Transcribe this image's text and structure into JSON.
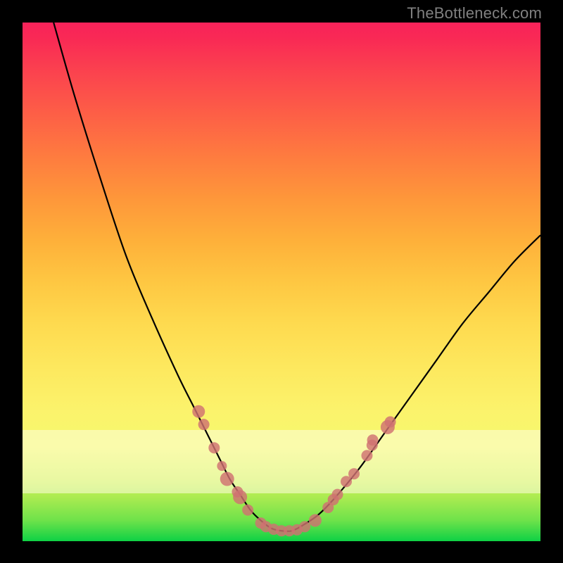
{
  "watermark": "TheBottleneck.com",
  "colors": {
    "frame": "#000000",
    "dot": "#d07272",
    "curve": "#000000",
    "gradient_top": "#f8225a",
    "gradient_bottom": "#0ed145"
  },
  "chart_data": {
    "type": "line",
    "title": "",
    "xlabel": "",
    "ylabel": "",
    "xlim": [
      0,
      100
    ],
    "ylim": [
      0,
      100
    ],
    "grid": false,
    "legend": false,
    "series": [
      {
        "name": "bottleneck-curve",
        "x": [
          6,
          10,
          15,
          20,
          25,
          30,
          33,
          36,
          38,
          40,
          42,
          44,
          46,
          48,
          50,
          52,
          54,
          57,
          60,
          65,
          70,
          75,
          80,
          85,
          90,
          95,
          100
        ],
        "values": [
          100,
          86,
          70,
          55,
          43,
          32,
          26,
          20,
          16,
          12,
          9,
          6,
          4,
          2.5,
          2,
          2,
          3,
          5,
          8,
          14,
          21,
          28,
          35,
          42,
          48,
          54,
          59
        ]
      }
    ],
    "markers": [
      {
        "x": 34.0,
        "y": 25.0,
        "r": 9
      },
      {
        "x": 35.0,
        "y": 22.5,
        "r": 8
      },
      {
        "x": 37.0,
        "y": 18.0,
        "r": 8
      },
      {
        "x": 38.5,
        "y": 14.5,
        "r": 7
      },
      {
        "x": 39.5,
        "y": 12.0,
        "r": 10
      },
      {
        "x": 41.5,
        "y": 9.5,
        "r": 8
      },
      {
        "x": 42.0,
        "y": 8.5,
        "r": 10
      },
      {
        "x": 43.5,
        "y": 6.0,
        "r": 8
      },
      {
        "x": 46.0,
        "y": 3.5,
        "r": 8
      },
      {
        "x": 47.0,
        "y": 2.8,
        "r": 8
      },
      {
        "x": 48.5,
        "y": 2.3,
        "r": 8
      },
      {
        "x": 50.0,
        "y": 2.0,
        "r": 8
      },
      {
        "x": 51.5,
        "y": 2.0,
        "r": 8
      },
      {
        "x": 53.0,
        "y": 2.2,
        "r": 8
      },
      {
        "x": 54.5,
        "y": 2.8,
        "r": 8
      },
      {
        "x": 56.5,
        "y": 4.0,
        "r": 9
      },
      {
        "x": 59.0,
        "y": 6.5,
        "r": 8
      },
      {
        "x": 60.0,
        "y": 8.0,
        "r": 8
      },
      {
        "x": 60.8,
        "y": 9.0,
        "r": 8
      },
      {
        "x": 62.5,
        "y": 11.5,
        "r": 8
      },
      {
        "x": 64.0,
        "y": 13.0,
        "r": 8
      },
      {
        "x": 66.5,
        "y": 16.5,
        "r": 8
      },
      {
        "x": 67.5,
        "y": 18.5,
        "r": 8
      },
      {
        "x": 67.6,
        "y": 19.5,
        "r": 8
      },
      {
        "x": 70.5,
        "y": 22.0,
        "r": 10
      },
      {
        "x": 71.0,
        "y": 23.0,
        "r": 8
      }
    ]
  }
}
